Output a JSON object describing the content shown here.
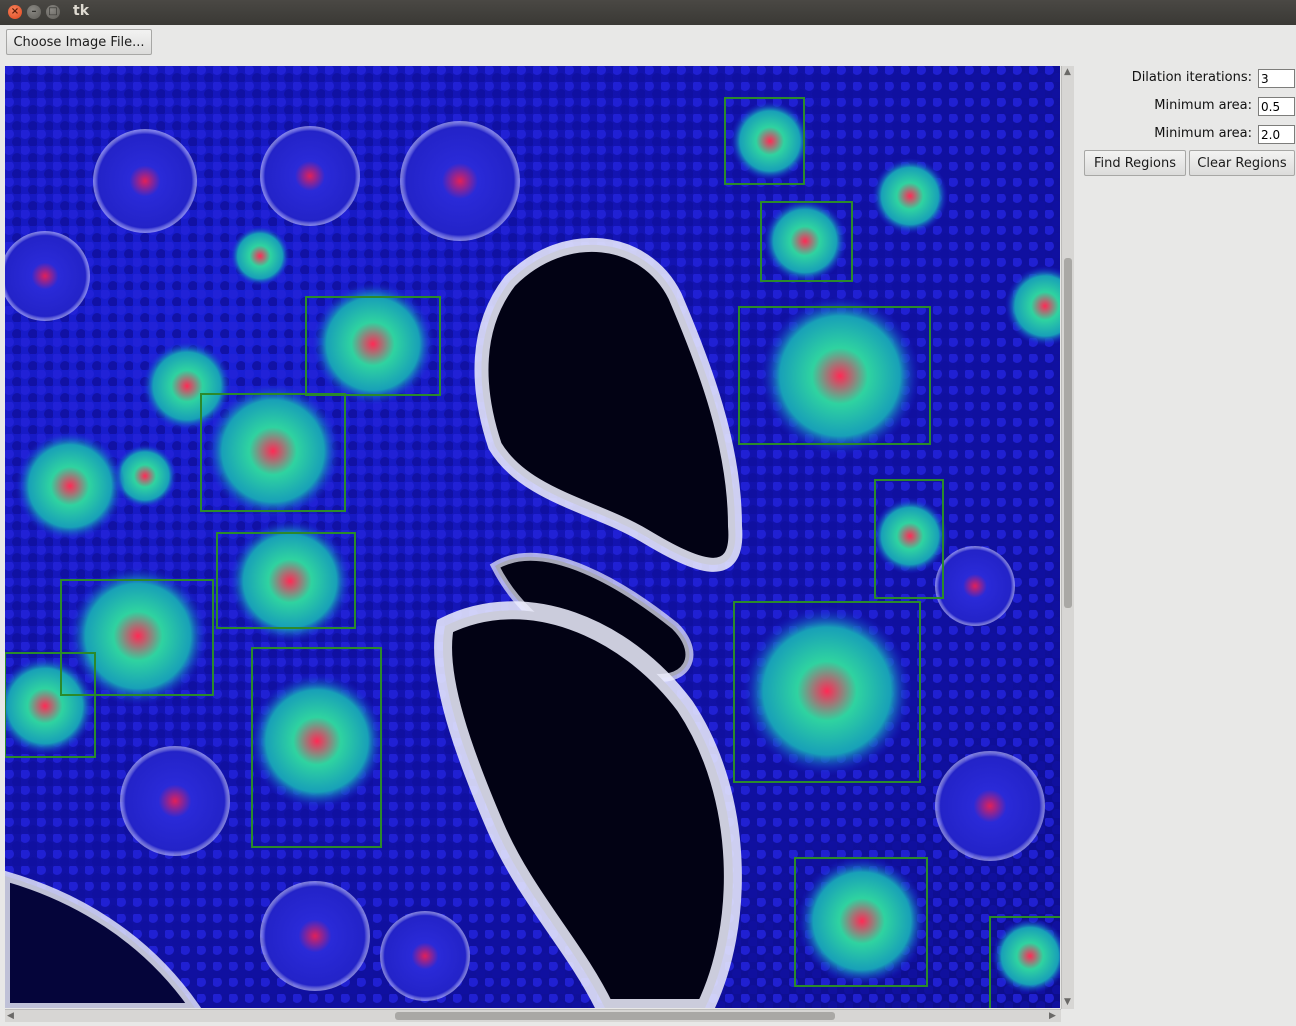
{
  "window": {
    "title": "tk",
    "close_glyph": "×",
    "min_glyph": "–",
    "max_glyph": "□"
  },
  "toolbar": {
    "choose_label": "Choose Image File..."
  },
  "params": {
    "dilation_label": "Dilation iterations:",
    "dilation_value": "3",
    "min_area_label": "Minimum area:",
    "min_area_value": "0.5",
    "max_area_label": "Minimum area:",
    "max_area_value": "2.0"
  },
  "actions": {
    "find_label": "Find Regions",
    "clear_label": "Clear Regions"
  },
  "colors": {
    "nuclei": "#1a1ad6",
    "signal_green": "#35e0a0",
    "signal_red": "#ff2a55",
    "membrane": "#eef0ff",
    "lumen": "#020214",
    "region_box": "#2b8a2b"
  },
  "icons": {
    "scroll_up": "▲",
    "scroll_down": "▼",
    "scroll_left": "◀",
    "scroll_right": "▶"
  }
}
